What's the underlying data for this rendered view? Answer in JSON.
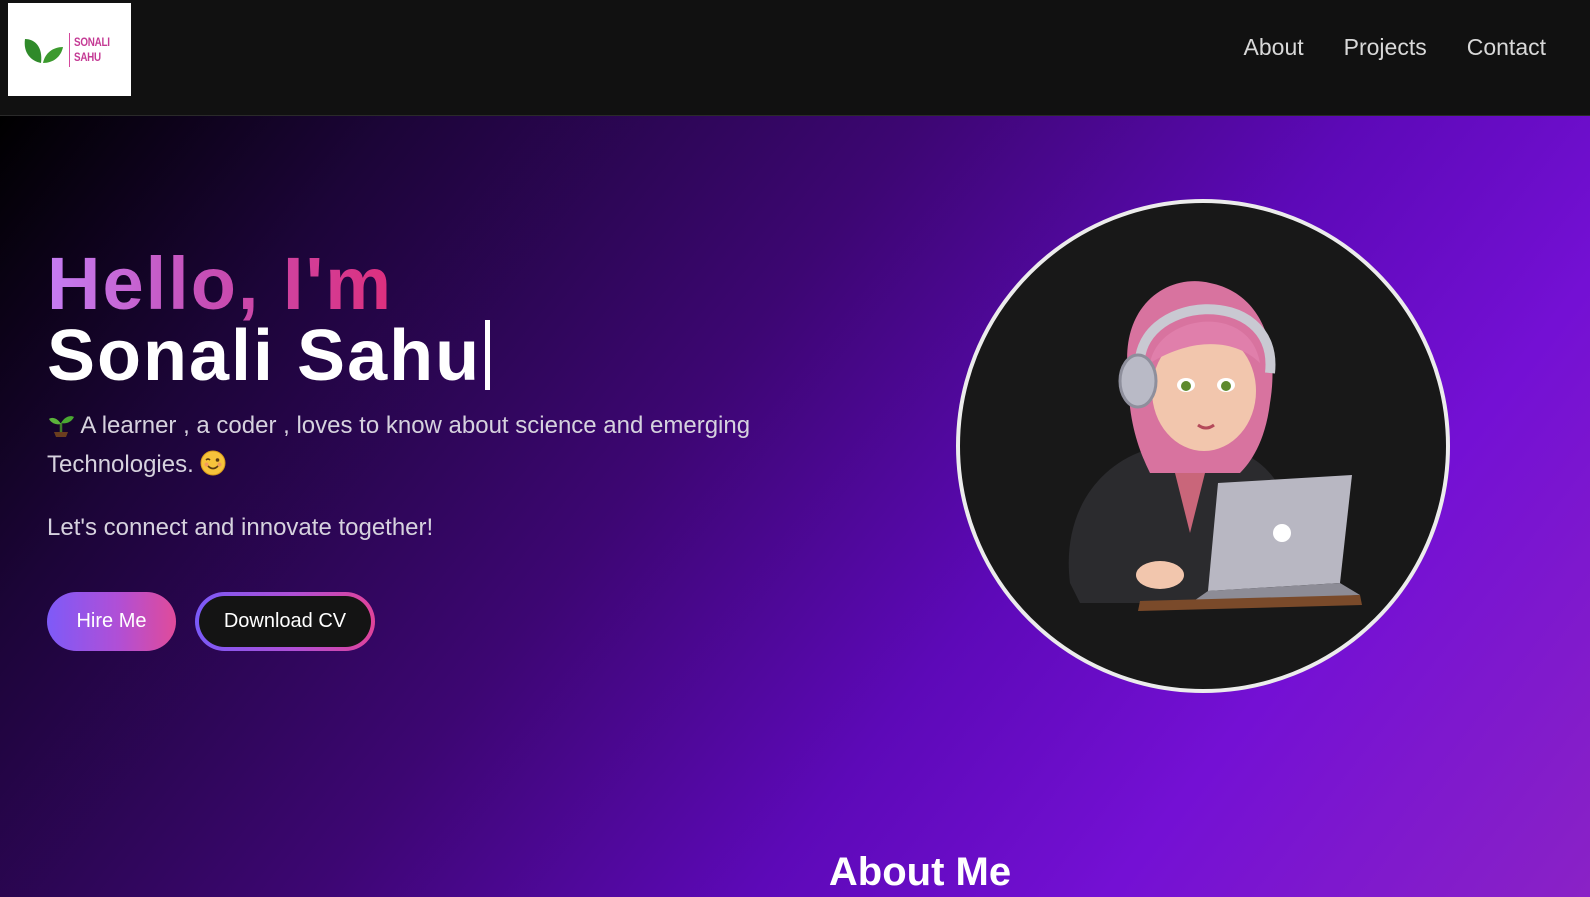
{
  "header": {
    "logo": {
      "line1": "SONALI",
      "line2": "SAHU",
      "icon": "leaf-icon"
    },
    "nav": [
      {
        "label": "About"
      },
      {
        "label": "Projects"
      },
      {
        "label": "Contact"
      }
    ]
  },
  "hero": {
    "greeting": "Hello, I'm",
    "name": "Sonali Sahu",
    "intro": "A learner , a coder , loves to know about science and emerging Technologies.",
    "intro_icons": [
      "sprout-emoji-icon",
      "wink-emoji-icon"
    ],
    "tagline": "Let's connect and innovate together!",
    "hire_button": "Hire Me",
    "cv_button": "Download CV",
    "avatar": "girl-with-laptop-avatar"
  },
  "about": {
    "title": "About Me"
  },
  "colors": {
    "header_bg": "#111111",
    "gradient_start": "#000000",
    "gradient_end": "#8a22c6",
    "accent_pink": "#dd2f7d",
    "accent_violet": "#7e5af8"
  }
}
